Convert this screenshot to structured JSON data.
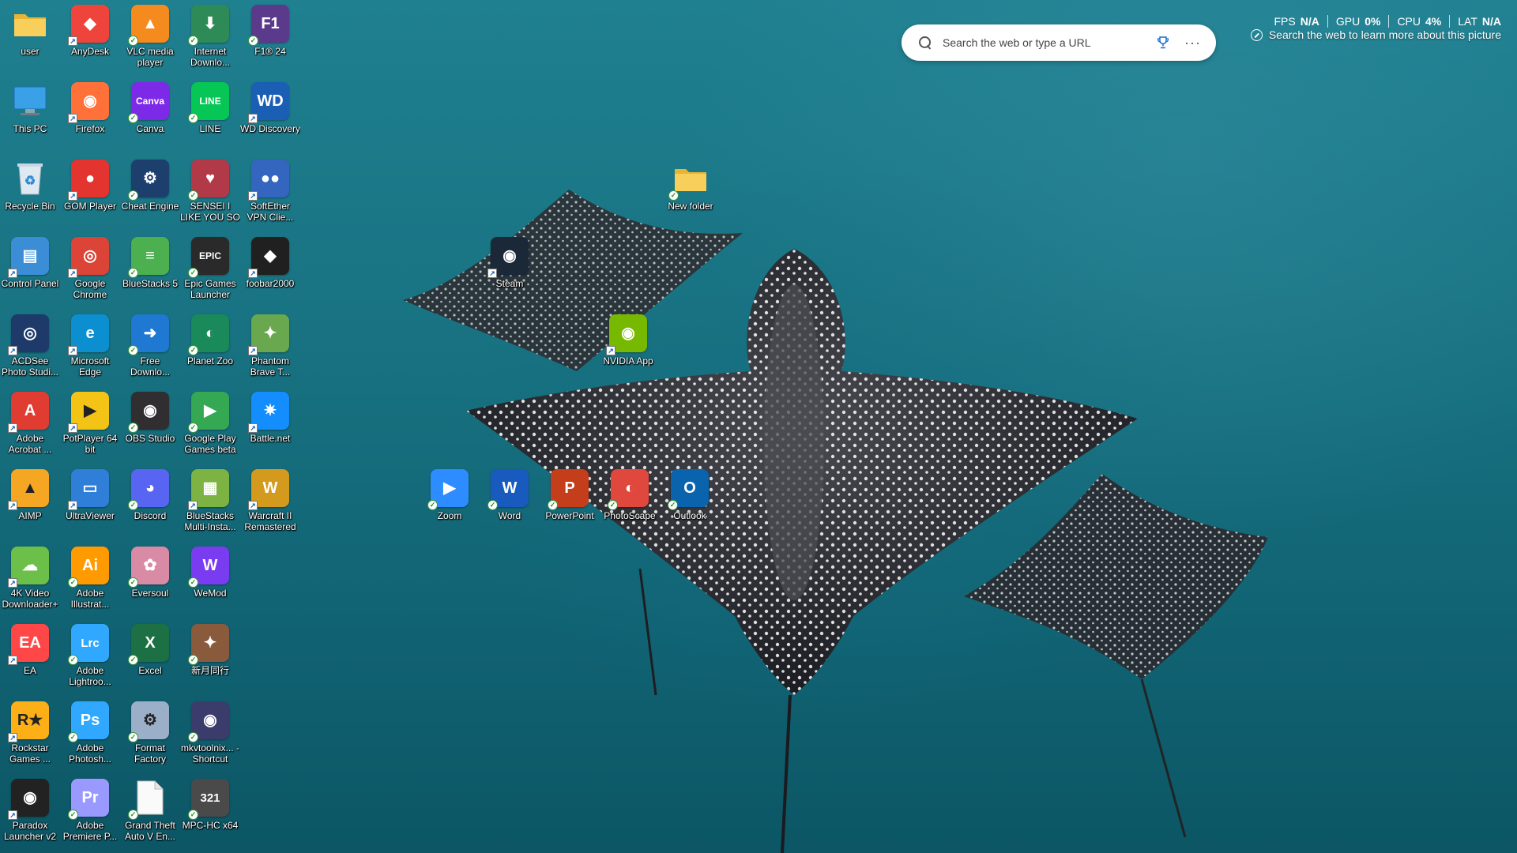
{
  "desktop": {
    "icons": [
      {
        "label": "user",
        "icon": "folder-icon",
        "glyph": "",
        "color": "#f3c744"
      },
      {
        "label": "AnyDesk",
        "icon": "anydesk-icon",
        "glyph": "◆",
        "color": "#ef443b"
      },
      {
        "label": "VLC media player",
        "icon": "vlc-icon",
        "glyph": "▲",
        "color": "#f58a1f"
      },
      {
        "label": "Internet Downlo...",
        "icon": "internet-download-manager-icon",
        "glyph": "⬇",
        "color": "#2e8b57"
      },
      {
        "label": "F1® 24",
        "icon": "f1-24-icon",
        "glyph": "F1",
        "color": "#5b3a8c"
      },
      {
        "label": "This PC",
        "icon": "monitor-icon",
        "glyph": "▭",
        "color": "#1e8fd6"
      },
      {
        "label": "Firefox",
        "icon": "firefox-icon",
        "glyph": "◉",
        "color": "#ff7139"
      },
      {
        "label": "Canva",
        "icon": "canva-icon",
        "glyph": "Canva",
        "color": "#7d2ae8"
      },
      {
        "label": "LINE",
        "icon": "line-icon",
        "glyph": "LINE",
        "color": "#06c755"
      },
      {
        "label": "WD Discovery",
        "icon": "wd-discovery-icon",
        "glyph": "WD",
        "color": "#1a5fb4"
      },
      {
        "label": "Recycle Bin",
        "icon": "recycle-bin-icon",
        "glyph": "♻",
        "color": "#9fbfd8"
      },
      {
        "label": "GOM Player",
        "icon": "gom-player-icon",
        "glyph": "●",
        "color": "#e3342f"
      },
      {
        "label": "Cheat Engine",
        "icon": "cheat-engine-icon",
        "glyph": "⚙",
        "color": "#1c3f6e"
      },
      {
        "label": "SENSEI I LIKE YOU SO M...",
        "icon": "game-anime-icon",
        "glyph": "♥",
        "color": "#b23a48"
      },
      {
        "label": "SoftEther VPN Clie...",
        "icon": "softether-vpn-icon",
        "glyph": "●●",
        "color": "#3466c0"
      },
      {
        "label": "Control Panel",
        "icon": "control-panel-icon",
        "glyph": "▤",
        "color": "#3b8ed6"
      },
      {
        "label": "Google Chrome",
        "icon": "chrome-icon",
        "glyph": "◎",
        "color": "#db4437"
      },
      {
        "label": "BlueStacks 5",
        "icon": "bluestacks-icon",
        "glyph": "≡",
        "color": "#4caf50"
      },
      {
        "label": "Epic Games Launcher",
        "icon": "epic-games-icon",
        "glyph": "EPIC",
        "color": "#2a2a2a"
      },
      {
        "label": "foobar2000",
        "icon": "foobar2000-icon",
        "glyph": "◆",
        "color": "#202020"
      },
      {
        "label": "ACDSee Photo Studi...",
        "icon": "acdsee-icon",
        "glyph": "◎",
        "color": "#1d3a6b"
      },
      {
        "label": "Microsoft Edge",
        "icon": "edge-icon",
        "glyph": "e",
        "color": "#0c8fd0"
      },
      {
        "label": "Free Downlo...",
        "icon": "free-download-manager-icon",
        "glyph": "➜",
        "color": "#1f78d1"
      },
      {
        "label": "Planet Zoo",
        "icon": "planet-zoo-icon",
        "glyph": "◐",
        "color": "#1b8a5a"
      },
      {
        "label": "Phantom Brave T...",
        "icon": "phantom-brave-icon",
        "glyph": "✦",
        "color": "#6aa84f"
      },
      {
        "label": "Adobe Acrobat ...",
        "icon": "acrobat-icon",
        "glyph": "A",
        "color": "#e03c31"
      },
      {
        "label": "PotPlayer 64 bit",
        "icon": "potplayer-icon",
        "glyph": "▶",
        "color": "#f3c316"
      },
      {
        "label": "OBS Studio",
        "icon": "obs-icon",
        "glyph": "◉",
        "color": "#302e31"
      },
      {
        "label": "Google Play Games beta",
        "icon": "google-play-games-icon",
        "glyph": "▶",
        "color": "#34a853"
      },
      {
        "label": "Battle.net",
        "icon": "battlenet-icon",
        "glyph": "✷",
        "color": "#148eff"
      },
      {
        "label": "AIMP",
        "icon": "aimp-icon",
        "glyph": "▲",
        "color": "#f5a623"
      },
      {
        "label": "UltraViewer",
        "icon": "ultraviewer-icon",
        "glyph": "▭",
        "color": "#2f7fd8"
      },
      {
        "label": "Discord",
        "icon": "discord-icon",
        "glyph": "◕",
        "color": "#5865f2"
      },
      {
        "label": "BlueStacks Multi-Insta...",
        "icon": "bluestacks-multi-instance-icon",
        "glyph": "▦",
        "color": "#7cb342"
      },
      {
        "label": "Warcraft II Remastered",
        "icon": "warcraft-icon",
        "glyph": "W",
        "color": "#d49a1e"
      },
      {
        "label": "4K Video Downloader+",
        "icon": "4k-video-downloader-icon",
        "glyph": "☁",
        "color": "#6cc04a"
      },
      {
        "label": "Adobe Illustrat...",
        "icon": "illustrator-icon",
        "glyph": "Ai",
        "color": "#ff9a00"
      },
      {
        "label": "Eversoul",
        "icon": "eversoul-icon",
        "glyph": "✿",
        "color": "#d98aa5"
      },
      {
        "label": "WeMod",
        "icon": "wemod-icon",
        "glyph": "W",
        "color": "#7a3cf0"
      },
      {
        "label": "",
        "icon": "",
        "glyph": "",
        "color": ""
      },
      {
        "label": "EA",
        "icon": "ea-icon",
        "glyph": "EA",
        "color": "#ff4747"
      },
      {
        "label": "Adobe Lightroo...",
        "icon": "lightroom-icon",
        "glyph": "Lrc",
        "color": "#31a8ff"
      },
      {
        "label": "Excel",
        "icon": "excel-icon",
        "glyph": "X",
        "color": "#1d7044"
      },
      {
        "label": "新月同行",
        "icon": "game-xinyue-icon",
        "glyph": "✦",
        "color": "#8a5a3c"
      },
      {
        "label": "",
        "icon": "",
        "glyph": "",
        "color": ""
      },
      {
        "label": "Rockstar Games ...",
        "icon": "rockstar-icon",
        "glyph": "R★",
        "color": "#fcaf17"
      },
      {
        "label": "Adobe Photosh...",
        "icon": "photoshop-icon",
        "glyph": "Ps",
        "color": "#31a8ff"
      },
      {
        "label": "Format Factory",
        "icon": "format-factory-icon",
        "glyph": "⚙",
        "color": "#9bb0c8"
      },
      {
        "label": "mkvtoolnix... - Shortcut",
        "icon": "mkvtoolnix-icon",
        "glyph": "◉",
        "color": "#3c3c6c"
      },
      {
        "label": "",
        "icon": "",
        "glyph": "",
        "color": ""
      },
      {
        "label": "Paradox Launcher v2",
        "icon": "paradox-icon",
        "glyph": "◉",
        "color": "#222"
      },
      {
        "label": "Adobe Premiere P...",
        "icon": "premiere-icon",
        "glyph": "Pr",
        "color": "#9999ff"
      },
      {
        "label": "Grand Theft Auto V En...",
        "icon": "file-icon",
        "glyph": "",
        "color": "#f5f5f5"
      },
      {
        "label": "MPC-HC x64",
        "icon": "mpc-hc-icon",
        "glyph": "321",
        "color": "#4a4a4a"
      },
      {
        "label": "",
        "icon": "",
        "glyph": "",
        "color": ""
      }
    ],
    "floating_icons": [
      {
        "label": "New folder",
        "icon": "folder-icon",
        "glyph": "",
        "color": "#f3c744"
      },
      {
        "label": "Steam",
        "icon": "steam-icon",
        "glyph": "◉",
        "color": "#1b2838"
      },
      {
        "label": "NVIDIA App",
        "icon": "nvidia-icon",
        "glyph": "◉",
        "color": "#76b900"
      },
      {
        "label": "Zoom",
        "icon": "zoom-icon",
        "glyph": "▶",
        "color": "#2d8cff"
      },
      {
        "label": "Word",
        "icon": "word-icon",
        "glyph": "W",
        "color": "#185abd"
      },
      {
        "label": "PowerPoint",
        "icon": "powerpoint-icon",
        "glyph": "P",
        "color": "#c43e1c"
      },
      {
        "label": "PhotoScape",
        "icon": "photoscape-icon",
        "glyph": "◐",
        "color": "#e0483e"
      },
      {
        "label": "Outlook",
        "icon": "outlook-icon",
        "glyph": "O",
        "color": "#0a64ad"
      }
    ]
  },
  "search": {
    "placeholder": "Search the web or type a URL"
  },
  "stats": {
    "fps_label": "FPS",
    "fps_value": "N/A",
    "gpu_label": "GPU",
    "gpu_value": "0%",
    "cpu_label": "CPU",
    "cpu_value": "4%",
    "lat_label": "LAT",
    "lat_value": "N/A",
    "learn_text": "Search the web to learn more about this picture"
  }
}
